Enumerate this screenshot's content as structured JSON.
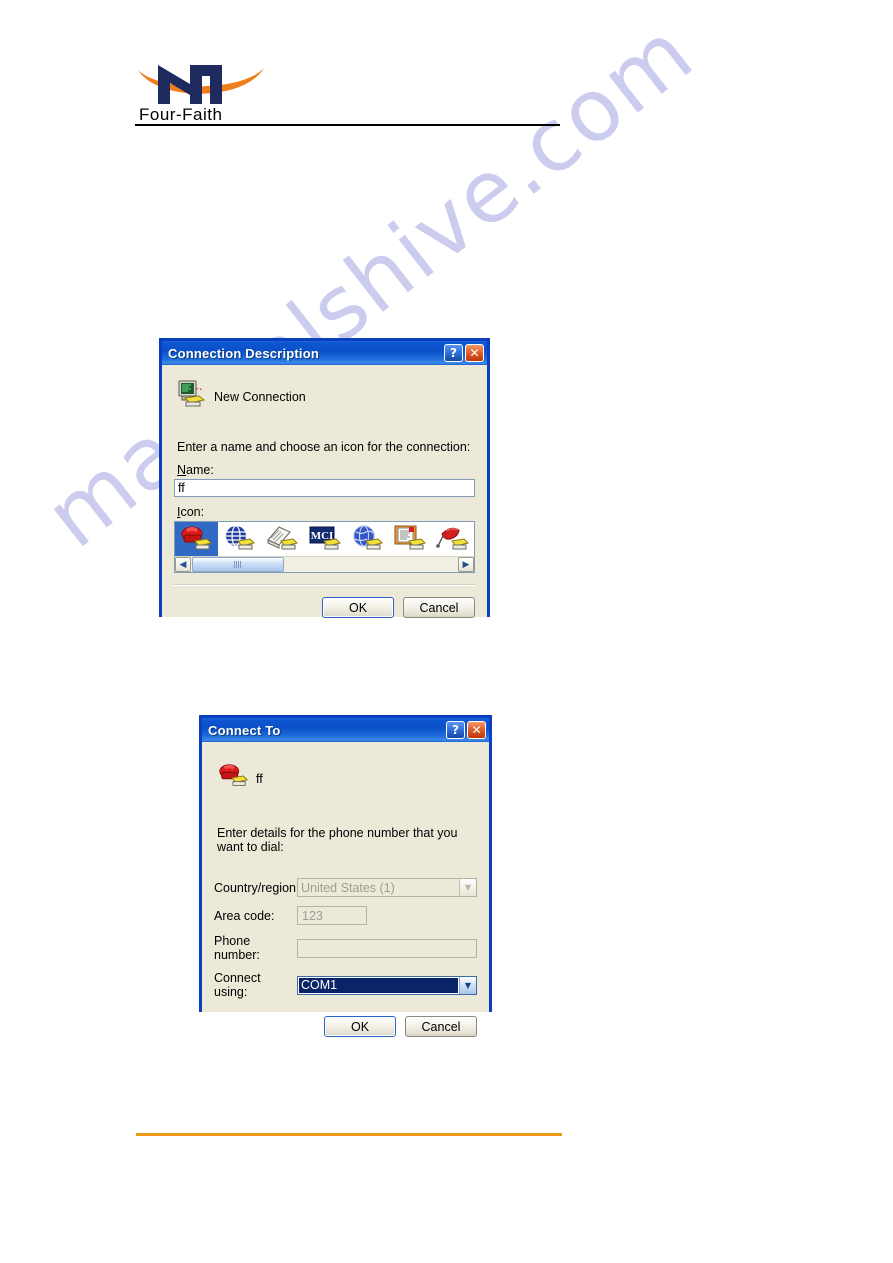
{
  "page": {
    "watermark_text": "manualshive.com",
    "accent_orange": "#eb9a18",
    "titlebar_blue": "#0a4fc8",
    "dialog_face": "#ece9d8"
  },
  "header": {
    "logo_name": "four-faith-logo",
    "brand_text": "Four-Faith"
  },
  "dialog_connection_description": {
    "title": "Connection Description",
    "help_button": "?",
    "close_button": "✕",
    "header_icon": "new-connection-icon",
    "header_label": "New Connection",
    "instruction": "Enter a name and choose an icon for the connection:",
    "name_label": "Name:",
    "name_label_accel": "N",
    "name_label_rest": "ame:",
    "name_value": "ff",
    "icon_label": "Icon:",
    "icon_label_accel": "I",
    "icon_label_rest": "con:",
    "icons": [
      {
        "name": "red-phone-icon",
        "selected": true
      },
      {
        "name": "blue-globe-disc-icon",
        "selected": false
      },
      {
        "name": "newspaper-icon",
        "selected": false
      },
      {
        "name": "mci-logo-icon",
        "selected": false
      },
      {
        "name": "blue-world-icon",
        "selected": false
      },
      {
        "name": "documents-icon",
        "selected": false
      },
      {
        "name": "red-kite-icon",
        "selected": false
      }
    ],
    "scroll_left_arrow": "◀",
    "scroll_right_arrow": "▶",
    "ok_label": "OK",
    "cancel_label": "Cancel"
  },
  "dialog_connect_to": {
    "title": "Connect To",
    "help_button": "?",
    "close_button": "✕",
    "header_icon": "red-phone-icon",
    "header_label": "ff",
    "instruction": "Enter details for the phone number that you want to dial:",
    "fields": [
      {
        "label": "Country/region:",
        "value": "United States (1)",
        "state": "disabled",
        "control": "combobox"
      },
      {
        "label": "Area code:",
        "value": "123",
        "state": "disabled",
        "control": "textbox"
      },
      {
        "label": "Phone number:",
        "value": "",
        "state": "enabled",
        "control": "textbox"
      },
      {
        "label": "Connect using:",
        "value": "COM1",
        "state": "selected",
        "control": "combobox"
      }
    ],
    "dropdown_arrow": "▼",
    "ok_label": "OK",
    "cancel_label": "Cancel"
  }
}
